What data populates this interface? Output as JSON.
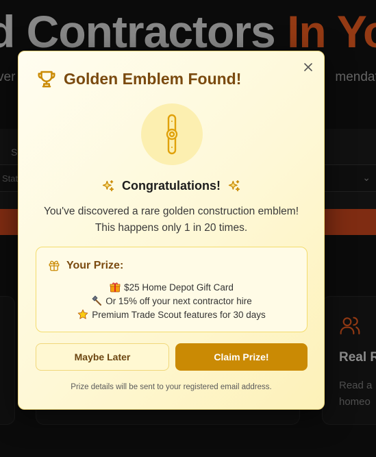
{
  "background": {
    "hero_title_main": "d Contractors",
    "hero_title_accent": "In Yo",
    "hero_sub_left": "ver",
    "hero_sub_right": "mendati",
    "search_label_left": "S",
    "search_label_right": "",
    "select_left_value": "State",
    "feature_card_title": "Real R",
    "feature_card_text_1": "Read a",
    "feature_card_text_2": "homeo"
  },
  "modal": {
    "title": "Golden Emblem Found!",
    "close_label": "×",
    "congrats": "Congratulations!",
    "description": "You've discovered a rare golden construction emblem! This happens only 1 in 20 times.",
    "prize_title": "Your Prize:",
    "prizes": [
      {
        "icon": "gift-emoji-icon",
        "text": "$25 Home Depot Gift Card"
      },
      {
        "icon": "hammer-icon",
        "text": "Or 15% off your next contractor hire"
      },
      {
        "icon": "star-icon",
        "text": "Premium Trade Scout features for 30 days"
      }
    ],
    "btn_later": "Maybe Later",
    "btn_claim": "Claim Prize!",
    "footnote": "Prize details will be sent to your registered email address."
  },
  "colors": {
    "accent_gold": "#ca8a04",
    "title_brown": "#7a4a0f",
    "hero_accent": "#e35a1f"
  }
}
